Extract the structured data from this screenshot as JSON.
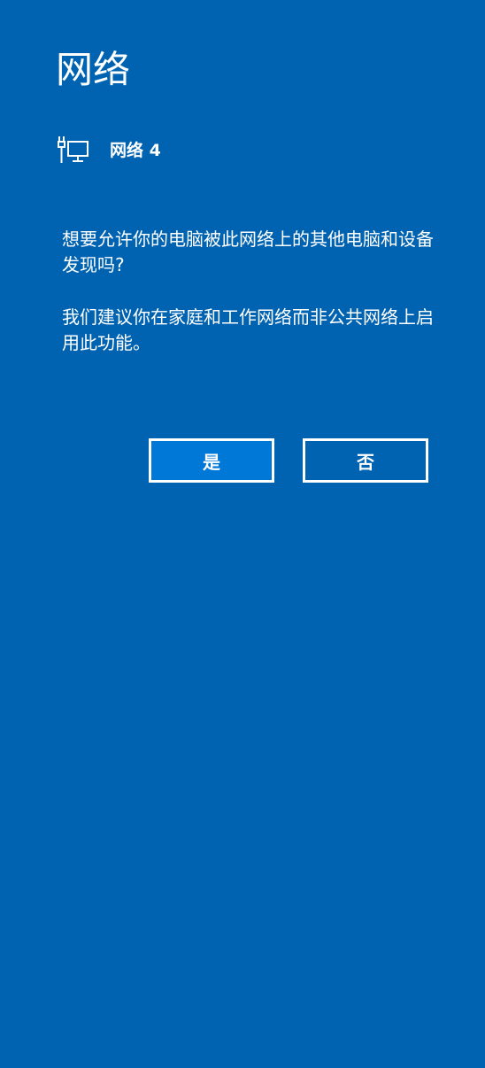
{
  "panel": {
    "title": "网络",
    "network_icon": "ethernet-network-icon",
    "network_name": "网络 4",
    "question": "想要允许你的电脑被此网络上的其他电脑和设备发现吗?",
    "recommendation": "我们建议你在家庭和工作网络而非公共网络上启用此功能。"
  },
  "buttons": {
    "yes_label": "是",
    "no_label": "否"
  },
  "colors": {
    "background": "#0063b1",
    "primary_button": "#0078d7",
    "text": "#ffffff"
  }
}
